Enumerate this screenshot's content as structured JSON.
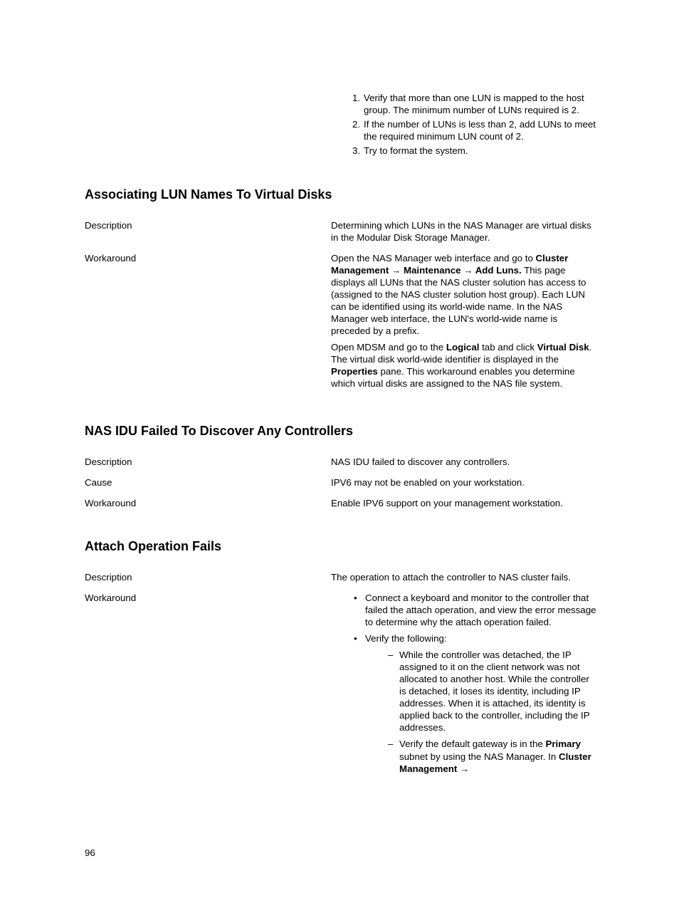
{
  "topList": [
    {
      "n": "1.",
      "text": "Verify that more than one LUN is mapped to the host group. The minimum number of LUNs required is 2."
    },
    {
      "n": "2.",
      "text": "If the number of LUNs is less than 2, add LUNs to meet the required minimum LUN count of 2."
    },
    {
      "n": "3.",
      "text": "Try to format the system."
    }
  ],
  "sec1": {
    "heading": "Associating LUN Names To Virtual Disks",
    "rows": {
      "descLabel": "Description",
      "descText": "Determining which LUNs in the NAS Manager are virtual disks in the Modular Disk Storage Manager.",
      "wkLabel": "Workaround",
      "p1a": "Open the NAS Manager web interface and go to ",
      "p1b": "Cluster Management → Maintenance → Add Luns.",
      "p1c": " This page displays all LUNs that the NAS cluster solution has access to (assigned to the NAS cluster solution host group). Each LUN can be identified using its world-wide name. In the NAS Manager web interface, the LUN's world-wide name is preceded by a prefix.",
      "p2a": "Open MDSM and go to the ",
      "p2b": "Logical",
      "p2c": " tab and click ",
      "p2d": "Virtual Disk",
      "p2e": ". The virtual disk world-wide identifier is displayed in the ",
      "p2f": "Properties",
      "p2g": " pane. This workaround enables you determine which virtual disks are assigned to the NAS file system."
    }
  },
  "sec2": {
    "heading": "NAS IDU Failed To Discover Any Controllers",
    "descLabel": "Description",
    "descText": "NAS IDU failed to discover any controllers.",
    "causeLabel": "Cause",
    "causeText": "IPV6 may not be enabled on your workstation.",
    "wkLabel": "Workaround",
    "wkText": "Enable IPV6 support on your management workstation."
  },
  "sec3": {
    "heading": "Attach Operation Fails",
    "descLabel": "Description",
    "descText": "The operation to attach the controller to NAS cluster fails.",
    "wkLabel": "Workaround",
    "b1": "Connect a keyboard and monitor to the controller that failed the attach operation, and view the error message to determine why the attach operation failed.",
    "b2": "Verify the following:",
    "d1": "While the controller was detached, the IP assigned to it on the client network was not allocated to another host. While the controller is detached, it loses its identity, including IP addresses. When it is attached, its identity is applied back to the controller, including the IP addresses.",
    "d2a": "Verify the default gateway is in the ",
    "d2b": "Primary",
    "d2c": " subnet by using the NAS Manager. In ",
    "d2d": "Cluster Management →"
  },
  "pageNumber": "96"
}
